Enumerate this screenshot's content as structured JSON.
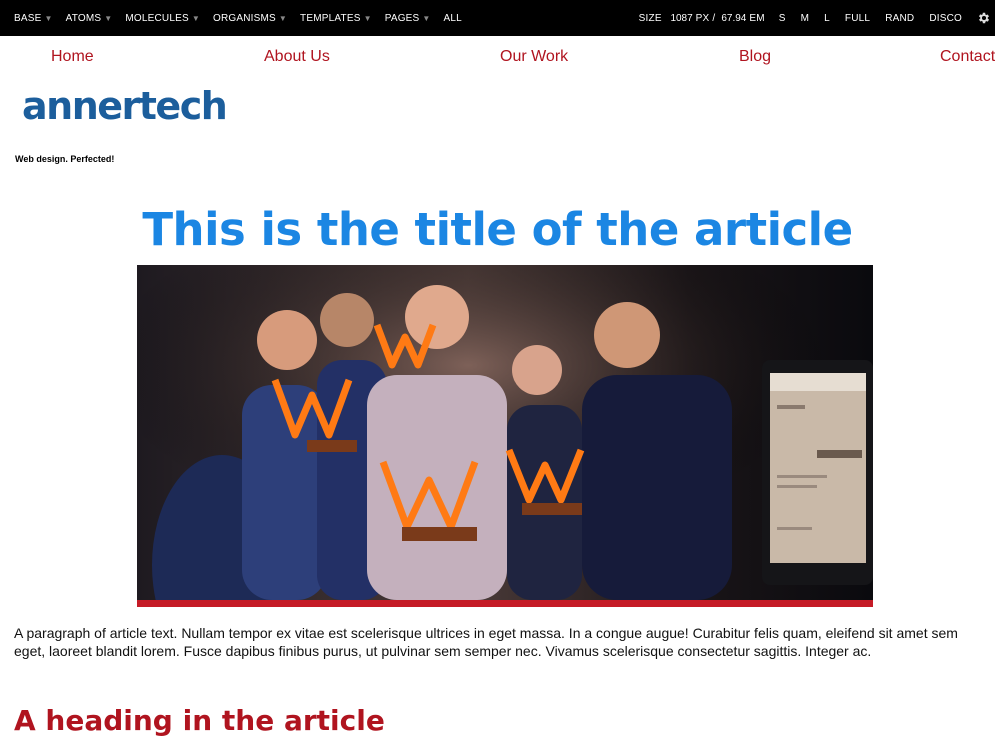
{
  "toolbar": {
    "left_items": [
      {
        "label": "BASE",
        "dropdown": true
      },
      {
        "label": "ATOMS",
        "dropdown": true
      },
      {
        "label": "MOLECULES",
        "dropdown": true
      },
      {
        "label": "ORGANISMS",
        "dropdown": true
      },
      {
        "label": "TEMPLATES",
        "dropdown": true
      },
      {
        "label": "PAGES",
        "dropdown": true
      },
      {
        "label": "ALL",
        "dropdown": false
      }
    ],
    "size_label": "SIZE",
    "size_px": "1087",
    "size_px_unit": "PX /",
    "size_em": "67.94",
    "size_em_unit": "EM",
    "right_items": [
      "S",
      "M",
      "L",
      "FULL",
      "RAND",
      "DISCO"
    ],
    "settings_icon": "gear-icon"
  },
  "nav": {
    "items": [
      "Home",
      "About Us",
      "Our Work",
      "Blog",
      "Contact"
    ],
    "color": "#b0141f"
  },
  "brand": {
    "logo_text": "annertech",
    "logo_color": "#1c5e9c",
    "tagline": "Web design. Perfected!"
  },
  "article": {
    "title": "This is the title of the article",
    "title_color": "#1b86e3",
    "image_accent": "#c51b26",
    "paragraph": "A paragraph of article text. Nullam tempor ex vitae est scelerisque ultrices in eget massa. In a congue augue! Curabitur felis quam, eleifend sit amet sem eget, laoreet blandit lorem. Fusce dapibus finibus purus, ut pulvinar sem semper nec. Vivamus scelerisque consectetur sagittis. Integer ac.",
    "heading": "A heading in the article",
    "heading_color": "#b0141f"
  }
}
